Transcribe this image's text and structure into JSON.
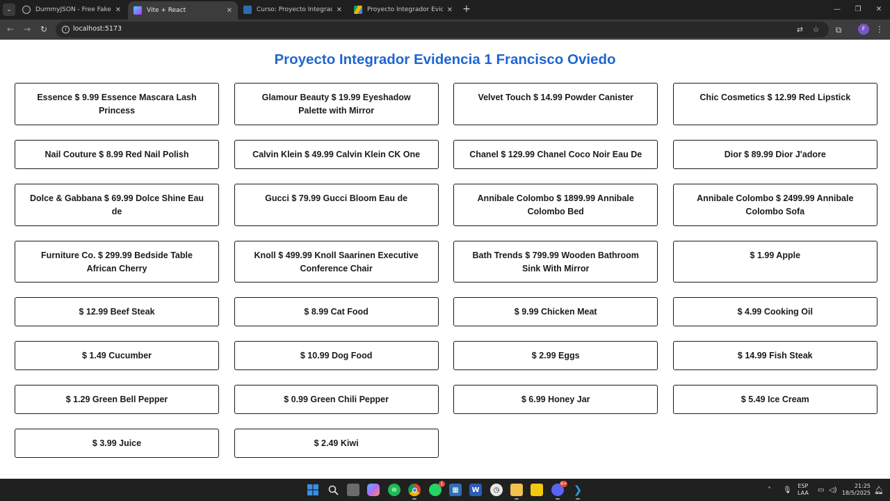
{
  "browser": {
    "tabs": [
      {
        "title": "DummyJSON - Free Fake REST API",
        "icon": "github-icon",
        "color": "#24292f",
        "active": false
      },
      {
        "title": "Vite + React",
        "icon": "vite-icon",
        "color": "#a855f7",
        "active": true
      },
      {
        "title": "Curso: Proyecto Integrador - TSU",
        "icon": "course-icon",
        "color": "#2b6cb0",
        "active": false
      },
      {
        "title": "Proyecto Integrador Evidencias",
        "icon": "google-drive-icon",
        "color": "#f4b400",
        "active": false
      }
    ],
    "url": "localhost:5173",
    "profile_initial": "F"
  },
  "page": {
    "title": "Proyecto Integrador Evidencia 1 Francisco Oviedo",
    "accent_color": "#1f66d0",
    "products": [
      "Essence $ 9.99 Essence Mascara Lash Princess",
      "Glamour Beauty $ 19.99 Eyeshadow Palette with Mirror",
      "Velvet Touch $ 14.99 Powder Canister",
      "Chic Cosmetics $ 12.99 Red Lipstick",
      "Nail Couture $ 8.99 Red Nail Polish",
      "Calvin Klein $ 49.99 Calvin Klein CK One",
      "Chanel $ 129.99 Chanel Coco Noir Eau De",
      "Dior $ 89.99 Dior J'adore",
      "Dolce & Gabbana $ 69.99 Dolce Shine Eau de",
      "Gucci $ 79.99 Gucci Bloom Eau de",
      "Annibale Colombo $ 1899.99 Annibale Colombo Bed",
      "Annibale Colombo $ 2499.99 Annibale Colombo Sofa",
      "Furniture Co. $ 299.99 Bedside Table African Cherry",
      "Knoll $ 499.99 Knoll Saarinen Executive Conference Chair",
      "Bath Trends $ 799.99 Wooden Bathroom Sink With Mirror",
      "$ 1.99 Apple",
      "$ 12.99 Beef Steak",
      "$ 8.99 Cat Food",
      "$ 9.99 Chicken Meat",
      "$ 4.99 Cooking Oil",
      "$ 1.49 Cucumber",
      "$ 10.99 Dog Food",
      "$ 2.99 Eggs",
      "$ 14.99 Fish Steak",
      "$ 1.29 Green Bell Pepper",
      "$ 0.99 Green Chili Pepper",
      "$ 6.99 Honey Jar",
      "$ 5.49 Ice Cream",
      "$ 3.99 Juice",
      "$ 2.49 Kiwi"
    ]
  },
  "taskbar": {
    "apps": [
      {
        "name": "windows-start-icon",
        "color": "#3a8ee6"
      },
      {
        "name": "search-icon",
        "color": "#3a3a3a"
      },
      {
        "name": "task-view-icon",
        "color": "#6b6b6b"
      },
      {
        "name": "copilot-icon",
        "color": "#6f7cf0"
      },
      {
        "name": "spotify-icon",
        "color": "#1db954"
      },
      {
        "name": "chrome-icon",
        "color": "#db4437"
      },
      {
        "name": "whatsapp-icon",
        "color": "#25d366"
      },
      {
        "name": "calculator-icon",
        "color": "#2f6fb3"
      },
      {
        "name": "word-icon",
        "color": "#2b5cb8"
      },
      {
        "name": "clock-app-icon",
        "color": "#e8e8e8"
      },
      {
        "name": "file-explorer-icon",
        "color": "#f2c14e"
      },
      {
        "name": "power-bi-icon",
        "color": "#f2c811"
      },
      {
        "name": "discord-icon",
        "color": "#5865f2"
      },
      {
        "name": "vscode-icon",
        "color": "#2a9ae5"
      }
    ],
    "whatsapp_badge": "1",
    "discord_badge": "9+",
    "language": "ESP",
    "keyboard": "LAA",
    "time": "21:25",
    "date": "18/5/2025"
  }
}
